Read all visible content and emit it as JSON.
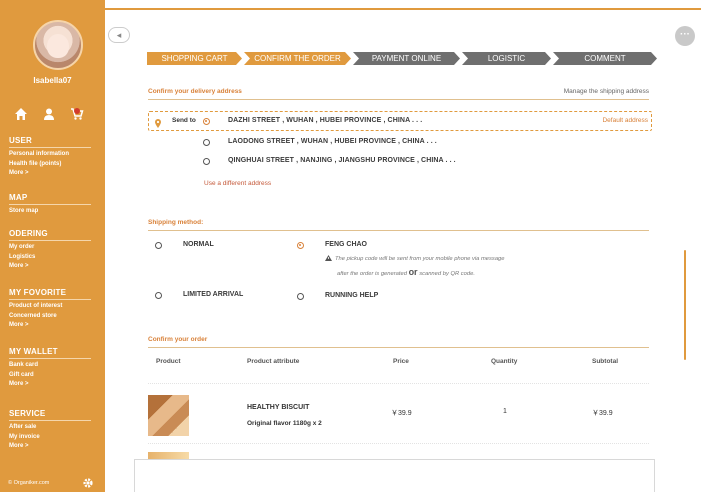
{
  "user": {
    "name": "Isabella07"
  },
  "sidebar": {
    "sections": [
      {
        "title": "USER",
        "items": [
          "Personal information",
          "Health file (points)",
          "More >"
        ]
      },
      {
        "title": "MAP",
        "items": [
          "Store map"
        ]
      },
      {
        "title": "ODERING",
        "items": [
          "My order",
          "Logistics",
          "More >"
        ]
      },
      {
        "title": "MY FOVORITE",
        "items": [
          "Product of interest",
          "Concerned store",
          "More >"
        ]
      },
      {
        "title": "MY WALLET",
        "items": [
          "Bank card",
          "Gift card",
          "More >"
        ]
      },
      {
        "title": "SERVICE",
        "items": [
          "After sale",
          "My invoice",
          "More >"
        ]
      }
    ],
    "footer": "© Organiker.com"
  },
  "steps": [
    "SHOPPING CART",
    "CONFIRM THE ORDER",
    "PAYMENT ONLINE",
    "LOGISTIC",
    "COMMENT"
  ],
  "address": {
    "title": "Confirm your delivery address",
    "manage": "Manage the shipping address",
    "send_to": "Send to",
    "default_tag": "Default address",
    "items": [
      "DAZHI STREET , WUHAN , HUBEI PROVINCE , CHINA . . .",
      "LAODONG STREET , WUHAN , HUBEI PROVINCE , CHINA . . .",
      "QINGHUAI STREET , NANJING , JIANGSHU PROVINCE , CHINA . . ."
    ],
    "use_different": "Use a different address"
  },
  "shipping": {
    "title": "Shipping method:",
    "options": [
      "NORMAL",
      "FENG CHAO",
      "LIMITED ARRIVAL",
      "RUNNING HELP"
    ],
    "selected": "FENG CHAO",
    "note_line1": "The pickup code will be sent from your mobile phone via message",
    "note_line2_a": "after the order is generated",
    "note_or": "or",
    "note_line2_b": "scanned by QR code."
  },
  "order": {
    "title": "Confirm your order",
    "headers": [
      "Product",
      "Product attribute",
      "Price",
      "Quantity",
      "Subtotal"
    ],
    "rows": [
      {
        "name": "HEALTHY  BISCUIT",
        "attribute": "Original flavor 1180g x 2",
        "price": "￥39.9",
        "quantity": "1",
        "subtotal": "￥39.9"
      }
    ]
  },
  "colors": {
    "accent": "#e09a3e",
    "step_inactive": "#6f6f6f",
    "link_red": "#c55a3b"
  }
}
